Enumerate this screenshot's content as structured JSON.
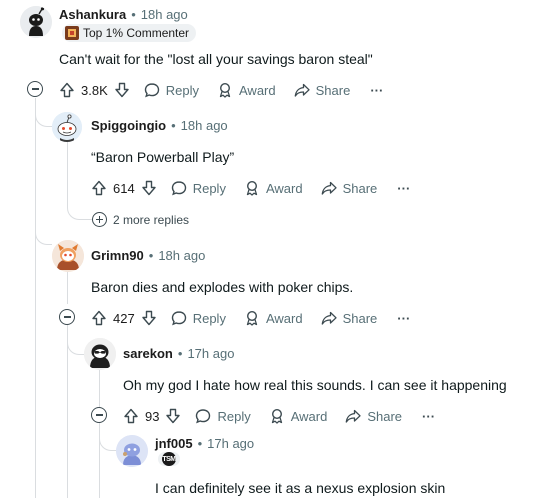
{
  "comments": [
    {
      "username": "Ashankura",
      "sep": "•",
      "time": "18h ago",
      "flair": "Top 1% Commenter",
      "body": "Can't wait for the \"lost all your savings baron steal\"",
      "votes": "3.8K",
      "reply": "Reply",
      "award": "Award",
      "share": "Share",
      "more": "···"
    },
    {
      "username": "Spiggoingio",
      "sep": "•",
      "time": "18h ago",
      "body": "“Baron Powerball Play”",
      "votes": "614",
      "reply": "Reply",
      "award": "Award",
      "share": "Share",
      "more": "···",
      "more_replies": "2 more replies"
    },
    {
      "username": "Grimn90",
      "sep": "•",
      "time": "18h ago",
      "body": "Baron dies and explodes with poker chips.",
      "votes": "427",
      "reply": "Reply",
      "award": "Award",
      "share": "Share",
      "more": "···"
    },
    {
      "username": "sarekon",
      "sep": "•",
      "time": "17h ago",
      "body": "Oh my god I hate how real this sounds. I can see it happening",
      "votes": "93",
      "reply": "Reply",
      "award": "Award",
      "share": "Share",
      "more": "···"
    },
    {
      "username": "jnf005",
      "sep": "•",
      "time": "17h ago",
      "flair_badge": "TSM",
      "body": "I can definitely see it as a nexus explosion skin"
    }
  ],
  "icons": {
    "upvote": "upvote-arrow-icon",
    "downvote": "downvote-arrow-icon",
    "reply": "speech-bubble-icon",
    "award": "award-ribbon-icon",
    "share": "share-arrow-icon",
    "collapse": "collapse-minus-icon",
    "expand": "expand-plus-icon"
  },
  "colors": {
    "meta": "#576f76",
    "thread_line": "#dadde0",
    "text": "#0f1a1c"
  }
}
